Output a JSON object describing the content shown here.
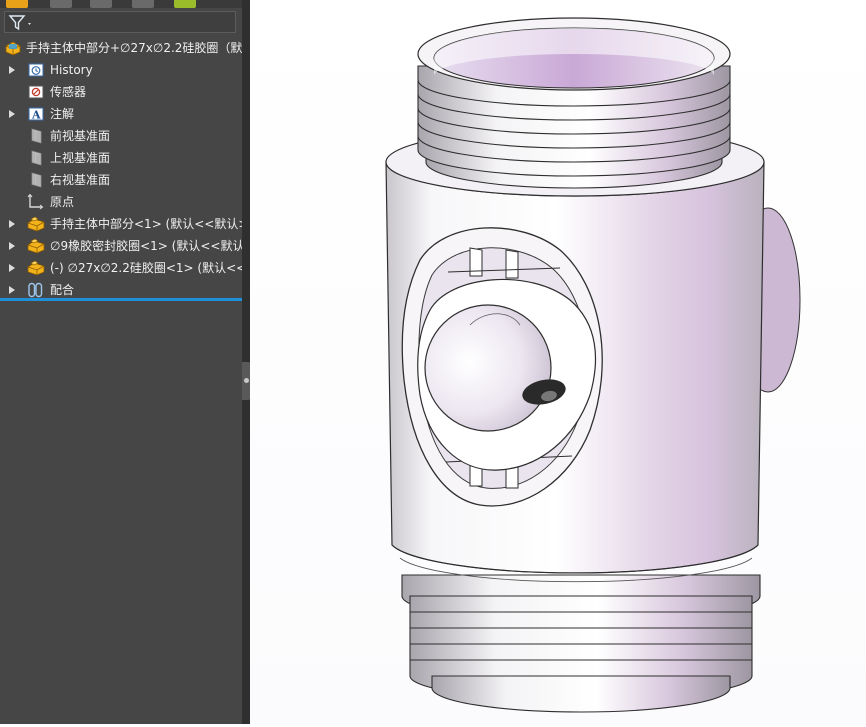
{
  "feature_tree": {
    "root": {
      "label": "手持主体中部分+∅27x∅2.2硅胶圈（默",
      "icon": "assembly-icon"
    },
    "items": [
      {
        "label": "History",
        "icon": "history-icon",
        "expandable": true
      },
      {
        "label": "传感器",
        "icon": "sensor-icon",
        "expandable": false
      },
      {
        "label": "注解",
        "icon": "annotation-icon",
        "expandable": true
      },
      {
        "label": "前视基准面",
        "icon": "plane-icon",
        "expandable": false
      },
      {
        "label": "上视基准面",
        "icon": "plane-icon",
        "expandable": false
      },
      {
        "label": "右视基准面",
        "icon": "plane-icon",
        "expandable": false
      },
      {
        "label": "原点",
        "icon": "origin-icon",
        "expandable": false
      },
      {
        "label": "手持主体中部分<1> (默认<<默认>",
        "icon": "part-icon",
        "expandable": true
      },
      {
        "label": "∅9橡胶密封胶圈<1> (默认<<默认",
        "icon": "part-icon",
        "expandable": true
      },
      {
        "label": "(-) ∅27x∅2.2硅胶圈<1> (默认<<",
        "icon": "part-icon",
        "expandable": true
      },
      {
        "label": "配合",
        "icon": "mates-icon",
        "expandable": true
      }
    ]
  },
  "colors": {
    "panel_bg": "#464646",
    "accent": "#1f8fd8",
    "part_icon": "#f2b21b",
    "model_tint": "#d8c6e0"
  }
}
